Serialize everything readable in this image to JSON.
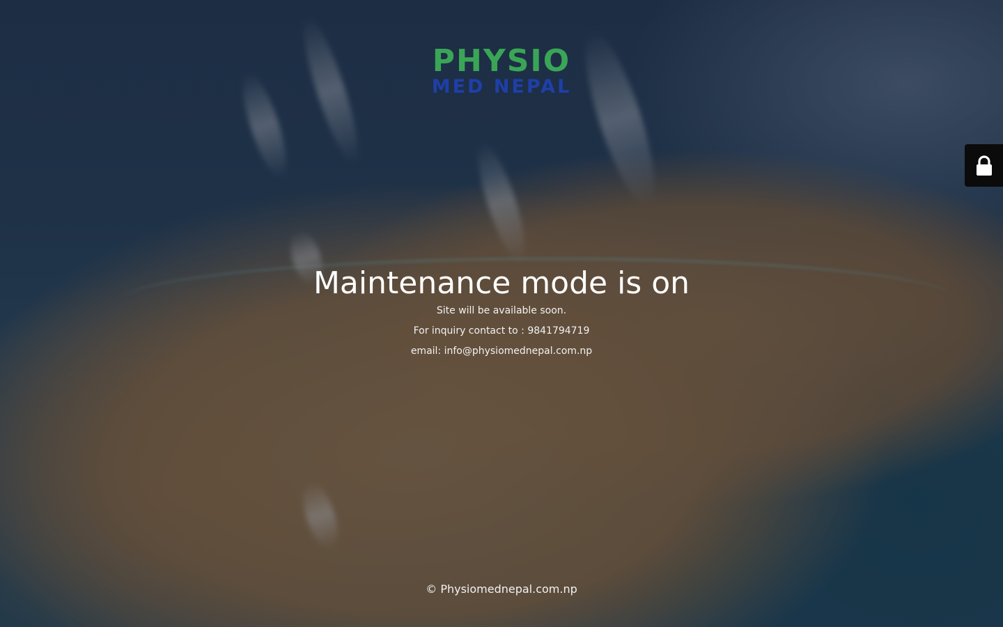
{
  "logo": {
    "line1": "PHYSIO",
    "line2": "MED NEPAL",
    "colors": {
      "primary": "#3aa556",
      "secondary": "#1f3fa8"
    }
  },
  "main": {
    "headline": "Maintenance mode is on",
    "line1": "Site will be available soon.",
    "line2": "For inquiry contact to : 9841794719",
    "line3": "email: info@physiomednepal.com.np"
  },
  "footer": {
    "copyright": "© Physiomednepal.com.np"
  },
  "login_tab": {
    "icon": "lock-icon"
  }
}
